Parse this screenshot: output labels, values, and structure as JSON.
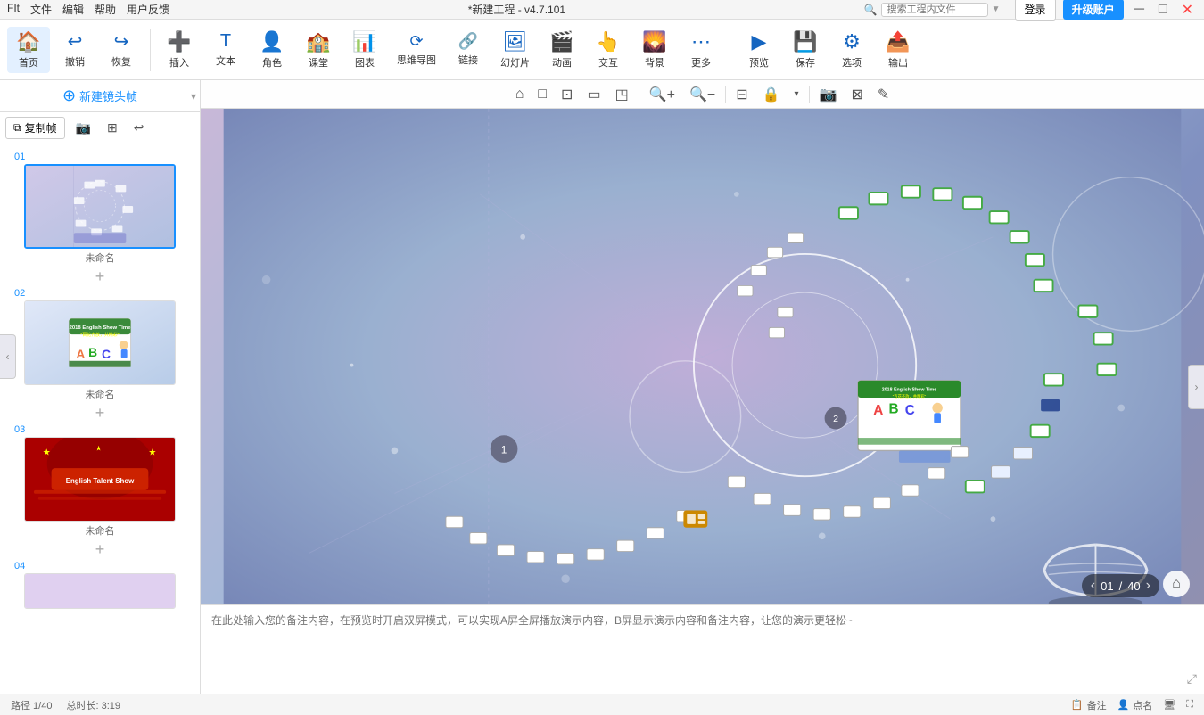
{
  "titleBar": {
    "left": [
      "FIt",
      "文件",
      "编辑",
      "帮助",
      "用户反馈"
    ],
    "center": "*新建工程 - v4.7.101",
    "searchPlaceholder": "搜索工程内文件",
    "login": "登录",
    "upgrade": "升级账户"
  },
  "toolbar": {
    "items": [
      {
        "id": "home",
        "icon": "🏠",
        "label": "首页"
      },
      {
        "id": "undo",
        "icon": "↩",
        "label": "撤销"
      },
      {
        "id": "redo",
        "icon": "↪",
        "label": "恢复"
      },
      {
        "id": "insert",
        "icon": "➕",
        "label": "插入"
      },
      {
        "id": "text",
        "icon": "📝",
        "label": "文本"
      },
      {
        "id": "character",
        "icon": "👤",
        "label": "角色"
      },
      {
        "id": "classroom",
        "icon": "🏫",
        "label": "课堂"
      },
      {
        "id": "chart",
        "icon": "📊",
        "label": "图表"
      },
      {
        "id": "mindmap",
        "icon": "🔗",
        "label": "思维导图"
      },
      {
        "id": "link",
        "icon": "🔗",
        "label": "链接"
      },
      {
        "id": "slide",
        "icon": "📑",
        "label": "幻灯片"
      },
      {
        "id": "animate",
        "icon": "🎬",
        "label": "动画"
      },
      {
        "id": "interact",
        "icon": "👆",
        "label": "交互"
      },
      {
        "id": "bg",
        "icon": "🖼",
        "label": "背景"
      },
      {
        "id": "more",
        "icon": "⋯",
        "label": "更多"
      },
      {
        "id": "preview",
        "icon": "▶",
        "label": "预览"
      },
      {
        "id": "save",
        "icon": "💾",
        "label": "保存"
      },
      {
        "id": "options",
        "icon": "⚙",
        "label": "选项"
      },
      {
        "id": "export",
        "icon": "📤",
        "label": "输出"
      }
    ]
  },
  "sidebar": {
    "newFrameLabel": "新建镜头帧",
    "copyBtn": "复制帧",
    "tools": [
      "📷",
      "🔲",
      "↩"
    ],
    "slides": [
      {
        "num": "01",
        "name": "未命名",
        "active": true
      },
      {
        "num": "02",
        "name": "未命名"
      },
      {
        "num": "03",
        "name": "未命名"
      },
      {
        "num": "04",
        "name": ""
      }
    ]
  },
  "canvasToolbar": {
    "icons": [
      "⌂",
      "□",
      "◱",
      "▭",
      "◳",
      "🔍+",
      "🔍-",
      "|",
      "🔒",
      "📷",
      "□",
      "✎"
    ]
  },
  "canvas": {
    "badge": "2",
    "circleCount": "1"
  },
  "notes": {
    "placeholder": "在此处输入您的备注内容，在预览时开启双屏模式，可以实现A屏全屏播放演示内容，B屏显示演示内容和备注内容，让您的演示更轻松~"
  },
  "nav": {
    "current": "01",
    "total": "40"
  },
  "statusBar": {
    "page": "路径 1/40",
    "duration": "总时长: 3:19",
    "notes": "备注",
    "points": "点名"
  }
}
